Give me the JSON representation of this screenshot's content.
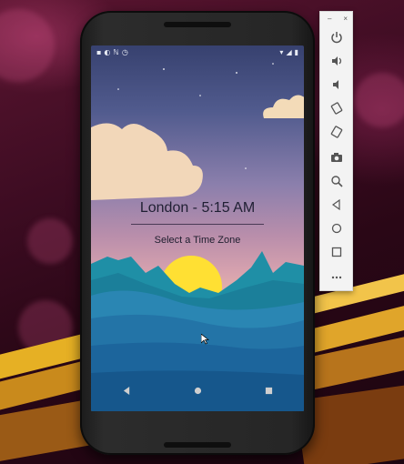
{
  "app": {
    "main_text": "London - 5:15 AM",
    "select_label": "Select a Time Zone"
  },
  "status_bar": {
    "left_icons": [
      "notification-icon",
      "sync-icon",
      "n-icon",
      "alarm-icon"
    ],
    "right_icons": [
      "wifi-icon",
      "signal-icon",
      "battery-icon"
    ]
  },
  "nav_bar": {
    "buttons": [
      "back-icon",
      "home-icon",
      "recents-icon"
    ]
  },
  "emulator_toolbar": {
    "window_controls": {
      "minimize": "–",
      "close": "×"
    },
    "buttons": [
      "power-icon",
      "volume-up-icon",
      "volume-down-icon",
      "rotate-left-icon",
      "rotate-right-icon",
      "camera-icon",
      "zoom-icon",
      "back-icon",
      "home-icon",
      "overview-icon",
      "more-icon"
    ]
  },
  "colors": {
    "sky_top": "#37416f",
    "sky_bottom": "#e4b2ab",
    "sun": "#ffe033",
    "mountain": "#1f8fa6",
    "water": "#1b5f94",
    "text": "#1f1f33"
  }
}
